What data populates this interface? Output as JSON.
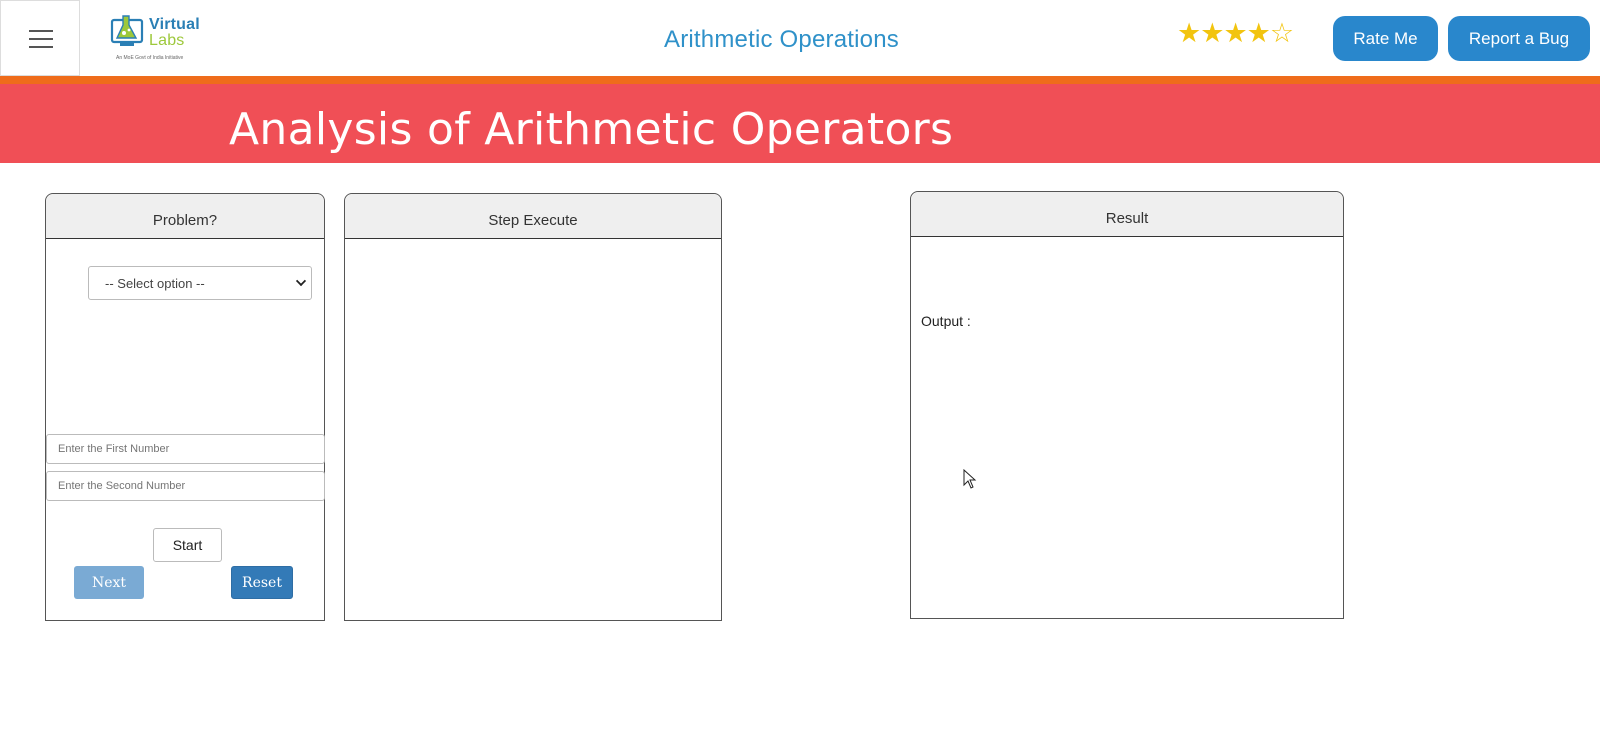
{
  "navbar": {
    "menu_icon": "hamburger-menu-icon",
    "logo": {
      "word1": "Virtual",
      "word2": "Labs",
      "tagline": "An MoE Govt of India Initiative"
    },
    "title": "Arithmetic Operations",
    "rating": {
      "value": 4,
      "max": 5
    },
    "rate_label": "Rate Me",
    "bug_label": "Report a Bug"
  },
  "banner": {
    "title": "Analysis of Arithmetic Operators"
  },
  "problem": {
    "title": "Problem?",
    "select_value": "-- Select option --",
    "first_placeholder": "Enter the First Number",
    "second_placeholder": "Enter the Second Number",
    "start_label": "Start",
    "next_label": "Next",
    "reset_label": "Reset"
  },
  "step": {
    "title": "Step Execute"
  },
  "result": {
    "title": "Result",
    "output_label": "Output :"
  },
  "colors": {
    "accent_blue": "#2987cc",
    "banner_red": "#f04f56",
    "stripe_orange": "#ef6c1b",
    "star_gold": "#f2c40f"
  }
}
